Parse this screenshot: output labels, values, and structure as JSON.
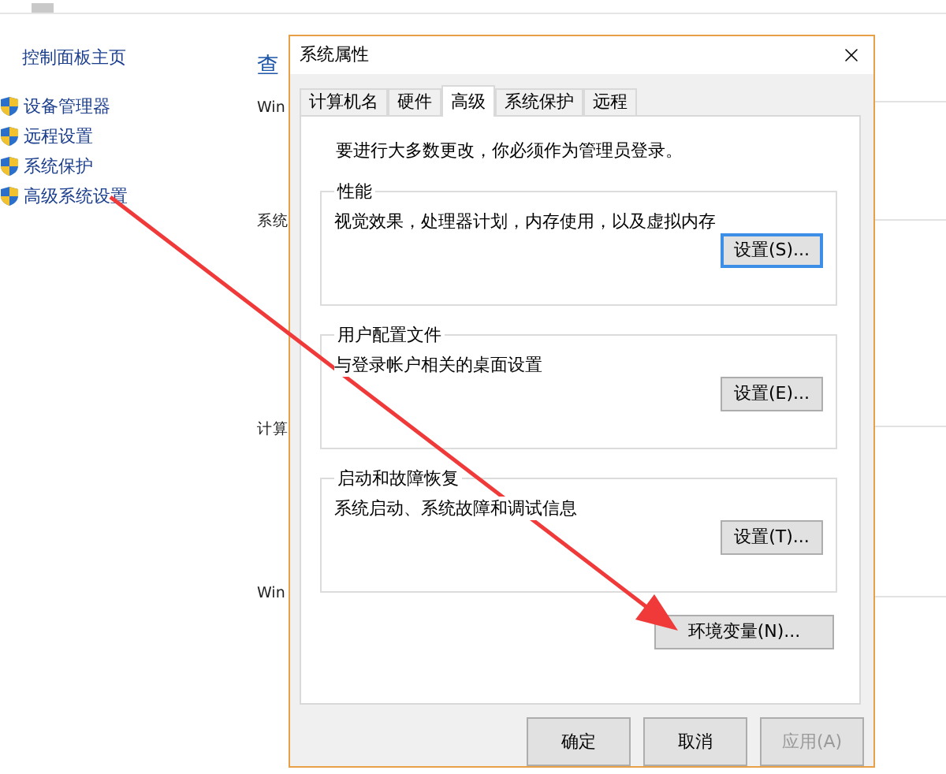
{
  "sidebar": {
    "home_link": "控制面板主页",
    "items": [
      {
        "label": "设备管理器"
      },
      {
        "label": "远程设置"
      },
      {
        "label": "系统保护"
      },
      {
        "label": "高级系统设置"
      }
    ]
  },
  "main": {
    "sections": [
      {
        "kind": "title",
        "text": "查"
      },
      {
        "kind": "section",
        "text": "Win"
      },
      {
        "kind": "section",
        "text": "系统"
      },
      {
        "kind": "section",
        "text": "计算"
      },
      {
        "kind": "section",
        "text": "Win"
      }
    ]
  },
  "dialog": {
    "title": "系统属性",
    "tabs": [
      {
        "label": "计算机名",
        "selected": false
      },
      {
        "label": "硬件",
        "selected": false
      },
      {
        "label": "高级",
        "selected": true
      },
      {
        "label": "系统保护",
        "selected": false
      },
      {
        "label": "远程",
        "selected": false
      }
    ],
    "notice": "要进行大多数更改，你必须作为管理员登录。",
    "groups": [
      {
        "title": "性能",
        "description": "视觉效果，处理器计划，内存使用，以及虚拟内存",
        "button": "设置(S)...",
        "focused": true
      },
      {
        "title": "用户配置文件",
        "description": "与登录帐户相关的桌面设置",
        "button": "设置(E)...",
        "focused": false
      },
      {
        "title": "启动和故障恢复",
        "description": "系统启动、系统故障和调试信息",
        "button": "设置(T)...",
        "focused": false
      }
    ],
    "env_button": "环境变量(N)...",
    "buttons": [
      {
        "label": "确定",
        "disabled": false
      },
      {
        "label": "取消",
        "disabled": false
      },
      {
        "label": "应用(A)",
        "disabled": true
      }
    ]
  }
}
